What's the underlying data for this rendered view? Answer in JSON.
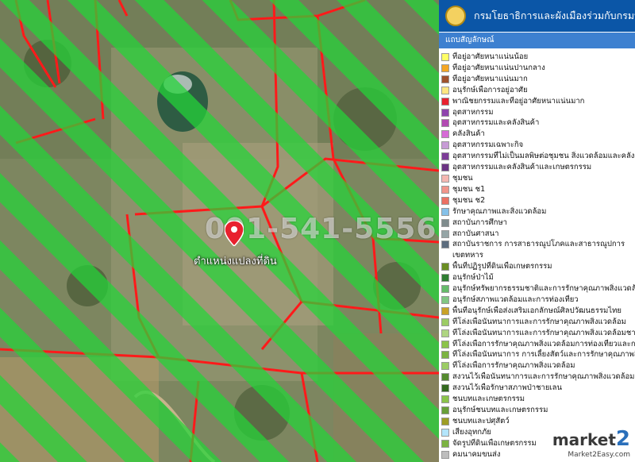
{
  "map": {
    "phone_watermark": "091-541-5556",
    "pin_label": "ตำแหน่งแปลงที่ดิน",
    "pin_icon": "map-pin-icon",
    "colors": {
      "zone_stripe": "#23d637",
      "parcel_line": "#ff1a1a",
      "pin": "#e8212e"
    }
  },
  "panel": {
    "title": "กรมโยธาธิการและผังเมืองร่วมกับกรมที่ดิน",
    "seal_icon": "government-seal-icon",
    "legend_title": "แถบสัญลักษณ์",
    "header_color": "#0b56a7",
    "legend_items": [
      {
        "label": "ที่อยู่อาศัยหนาแน่นน้อย",
        "color": "#ffff66"
      },
      {
        "label": "ที่อยู่อาศัยหนาแน่นปานกลาง",
        "color": "#f5a623"
      },
      {
        "label": "ที่อยู่อาศัยหนาแน่นมาก",
        "color": "#a0522d"
      },
      {
        "label": "อนุรักษ์เพื่อการอยู่อาศัย",
        "color": "#ffe680"
      },
      {
        "label": "พาณิชยกรรมและที่อยู่อาศัยหนาแน่นมาก",
        "color": "#e8212e"
      },
      {
        "label": "อุตสาหกรรม",
        "color": "#8e44ad"
      },
      {
        "label": "อุตสาหกรรมและคลังสินค้า",
        "color": "#b24ab2"
      },
      {
        "label": "คลังสินค้า",
        "color": "#d66bd6"
      },
      {
        "label": "อุตสาหกรรมเฉพาะกิจ",
        "color": "#c79bd6"
      },
      {
        "label": "อุตสาหกรรมที่ไม่เป็นมลพิษต่อชุมชน สิ่งแวดล้อมและคลังสินค้า",
        "color": "#7d3c98"
      },
      {
        "label": "อุตสาหกรรมและคลังสินค้าและเกษตรกรรม",
        "color": "#6c3483"
      },
      {
        "label": "ชุมชน",
        "color": "#f5b7b1"
      },
      {
        "label": "ชุมชน ช1",
        "color": "#f1948a"
      },
      {
        "label": "ชุมชน ช2",
        "color": "#ec7063"
      },
      {
        "label": "รักษาคุณภาพและสิ่งแวดล้อม",
        "color": "#85c1e9"
      },
      {
        "label": "สถาบันการศึกษา",
        "color": "#7f8c8d"
      },
      {
        "label": "สถาบันศาสนา",
        "color": "#95a5a6"
      },
      {
        "label": "สถาบันราชการ การสาธารณูปโภคและสาธารณูปการ เขตทหาร",
        "color": "#5d6d7e"
      },
      {
        "label": "พื้นที่ปฏิรูปที่ดินเพื่อเกษตรกรรม",
        "color": "#6b8e23"
      },
      {
        "label": "อนุรักษ์ป่าไม้",
        "color": "#2e7d32"
      },
      {
        "label": "อนุรักษ์ทรัพยากรธรรมชาติและการรักษาคุณภาพสิ่งแวดล้อม",
        "color": "#66bb6a"
      },
      {
        "label": "อนุรักษ์สภาพแวดล้อมและการท่องเที่ยว",
        "color": "#81c784"
      },
      {
        "label": "พื้นที่อนุรักษ์เพื่อส่งเสริมเอกลักษณ์ศิลปวัฒนธรรมไทย",
        "color": "#c9a227"
      },
      {
        "label": "ที่โล่งเพื่อนันทนาการและการรักษาคุณภาพสิ่งแวดล้อม",
        "color": "#9ccc65"
      },
      {
        "label": "ที่โล่งเพื่อนันทนาการและการรักษาคุณภาพสิ่งแวดล้อมชายฝั่งทะเล",
        "color": "#aed581"
      },
      {
        "label": "ที่โล่งเพื่อการรักษาคุณภาพสิ่งแวดล้อมการท่องเที่ยวและการประมง",
        "color": "#8bc34a"
      },
      {
        "label": "ที่โล่งเพื่อนันทนาการ การเลี้ยงสัตว์และการรักษาคุณภาพสิ่งแวดล้อม",
        "color": "#7cb342"
      },
      {
        "label": "ที่โล่งเพื่อการรักษาคุณภาพสิ่งแวดล้อม",
        "color": "#9ccc65"
      },
      {
        "label": "สงวนไว้เพื่อนันทนาการและการรักษาคุณภาพสิ่งแวดล้อม",
        "color": "#558b2f"
      },
      {
        "label": "สงวนไว้เพื่อรักษาสภาพป่าชายเลน",
        "color": "#33691e"
      },
      {
        "label": "ชนบทและเกษตรกรรม",
        "color": "#8bc34a"
      },
      {
        "label": "อนุรักษ์ชนบทและเกษตรกรรม",
        "color": "#689f38"
      },
      {
        "label": "ชนบทและปศุสัตว์",
        "color": "#9e9d24"
      },
      {
        "label": "เสี่ยงอุทกภัย",
        "color": "#b3e5fc"
      },
      {
        "label": "จัดรูปที่ดินเพื่อเกษตรกรรม",
        "color": "#7cb342"
      },
      {
        "label": "คมนาคมขนส่ง",
        "color": "#bdbdbd"
      }
    ]
  },
  "watermark": {
    "brand": "market",
    "brand_suffix": "2",
    "site": "Market2Easy.com"
  }
}
